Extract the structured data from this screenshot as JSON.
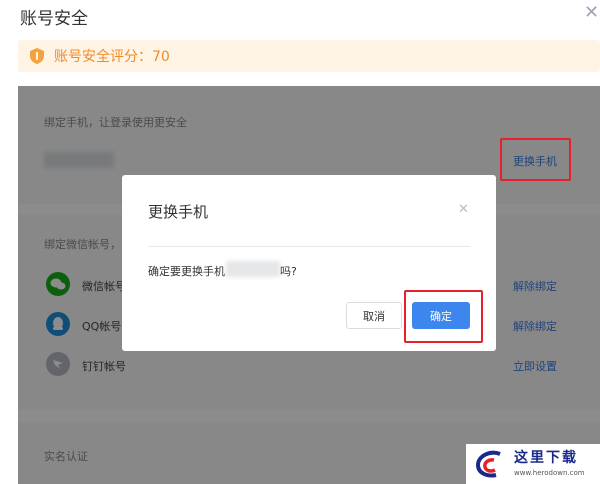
{
  "window": {
    "title": "账号安全",
    "close_glyph": "✕"
  },
  "score": {
    "text": "账号安全评分：70",
    "icon": "shield-icon",
    "color": "#ee8b2b"
  },
  "phone_section": {
    "label": "绑定手机，让登录使用更安全",
    "action": "更换手机"
  },
  "wechat_section": {
    "label": "绑定微信帐号，",
    "accounts": [
      {
        "name": "微信帐号",
        "icon": "wechat-icon",
        "action": "解除绑定"
      },
      {
        "name": "QQ帐号",
        "icon": "qq-icon",
        "action": "解除绑定"
      },
      {
        "name": "钉钉帐号",
        "icon": "dingtalk-icon",
        "action": "立即设置"
      }
    ]
  },
  "realname_section": {
    "label": "实名认证"
  },
  "dialog": {
    "title": "更换手机",
    "close_glyph": "✕",
    "message_prefix": "确定要更换手机",
    "message_suffix": "吗?",
    "cancel_label": "取消",
    "confirm_label": "确定"
  },
  "watermark": {
    "text": "这里下载",
    "url": "www.herodown.com"
  },
  "colors": {
    "accent": "#3d86ee",
    "link": "#3c7be0",
    "highlight": "#e8202a",
    "warning": "#ee8b2b"
  }
}
